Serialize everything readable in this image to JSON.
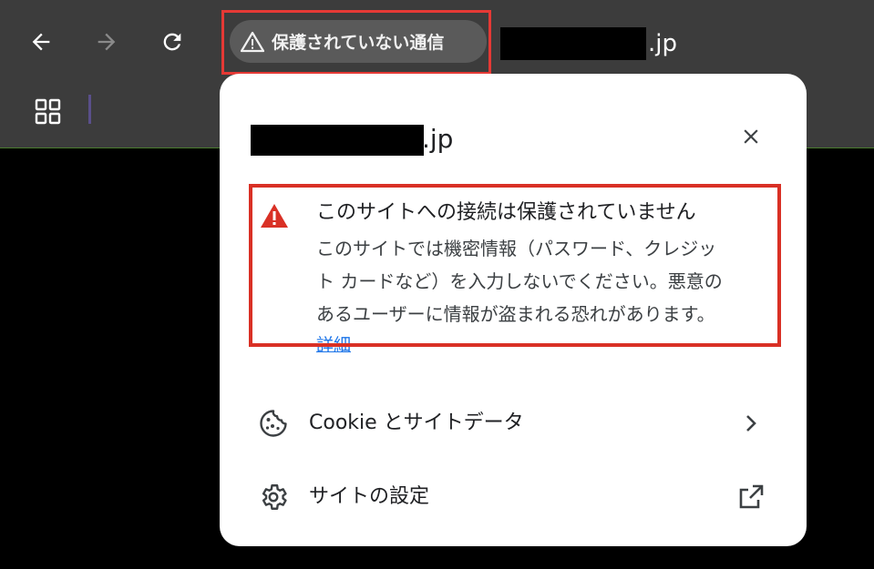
{
  "toolbar": {
    "security_chip_label": "保護されていない通信",
    "url_suffix": ".jp"
  },
  "popup": {
    "domain_suffix": ".jp",
    "warning": {
      "title": "このサイトへの接続は保護されていません",
      "body_lines": [
        "このサイトでは機密情報（パスワード、クレジッ",
        "ト カードなど）を入力しないでください。悪意の",
        "あるユーザーに情報が盗まれる恐れがあります。"
      ],
      "details_link": "詳細"
    },
    "rows": {
      "cookies_label": "Cookie とサイトデータ",
      "site_settings_label": "サイトの設定"
    }
  },
  "colors": {
    "toolbar_bg": "#3c3c3c",
    "chip_bg": "#5a5a5a",
    "highlight_red": "#d93025",
    "link_blue": "#1a73e8"
  },
  "icons": {
    "back": "arrow-left-icon",
    "forward": "arrow-right-icon",
    "reload": "reload-icon",
    "warning": "warning-triangle-icon",
    "apps": "apps-grid-icon",
    "close": "close-icon",
    "cookie": "cookie-icon",
    "chevron": "chevron-right-icon",
    "gear": "gear-icon",
    "external": "open-external-icon"
  }
}
